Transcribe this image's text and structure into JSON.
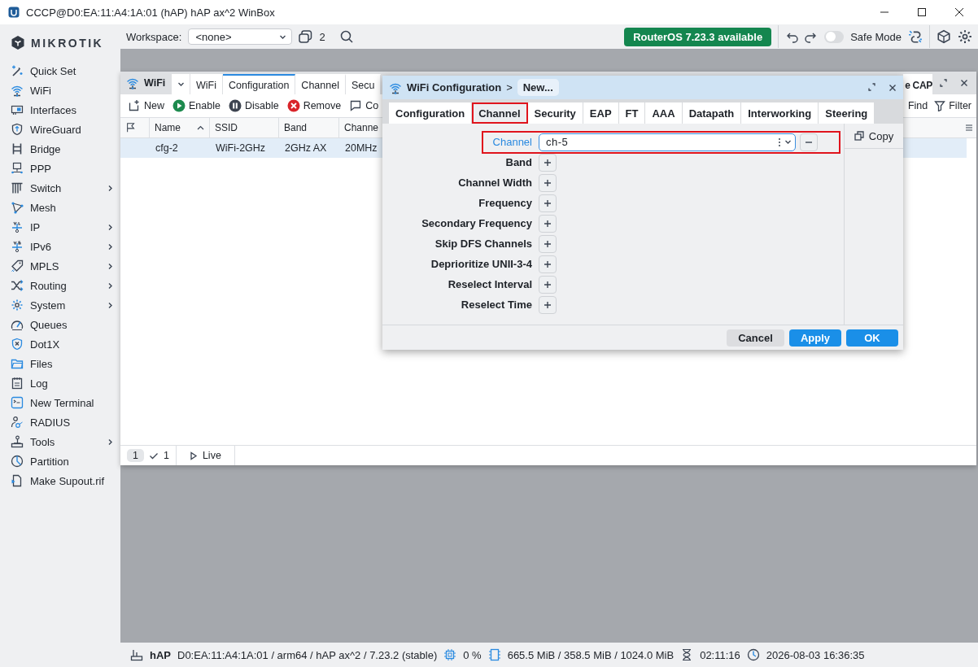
{
  "window": {
    "title": "CCCP@D0:EA:11:A4:1A:01 (hAP) hAP ax^2 WinBox"
  },
  "sidebar": {
    "brand": "MIKROTIK",
    "items": [
      {
        "label": "Quick Set",
        "submenu": false
      },
      {
        "label": "WiFi",
        "submenu": false
      },
      {
        "label": "Interfaces",
        "submenu": false
      },
      {
        "label": "WireGuard",
        "submenu": false
      },
      {
        "label": "Bridge",
        "submenu": false
      },
      {
        "label": "PPP",
        "submenu": false
      },
      {
        "label": "Switch",
        "submenu": true
      },
      {
        "label": "Mesh",
        "submenu": false
      },
      {
        "label": "IP",
        "submenu": true
      },
      {
        "label": "IPv6",
        "submenu": true
      },
      {
        "label": "MPLS",
        "submenu": true
      },
      {
        "label": "Routing",
        "submenu": true
      },
      {
        "label": "System",
        "submenu": true
      },
      {
        "label": "Queues",
        "submenu": false
      },
      {
        "label": "Dot1X",
        "submenu": false
      },
      {
        "label": "Files",
        "submenu": false
      },
      {
        "label": "Log",
        "submenu": false
      },
      {
        "label": "New Terminal",
        "submenu": false
      },
      {
        "label": "RADIUS",
        "submenu": false
      },
      {
        "label": "Tools",
        "submenu": true
      },
      {
        "label": "Partition",
        "submenu": false
      },
      {
        "label": "Make Supout.rif",
        "submenu": false
      }
    ]
  },
  "toolbar": {
    "workspace_label": "Workspace:",
    "workspace_value": "<none>",
    "windows_count": "2",
    "update_badge": "RouterOS 7.23.3 available",
    "safe_mode": {
      "label": "Safe Mode",
      "on": false
    }
  },
  "wifi_window": {
    "title": "WiFi",
    "tabs": [
      {
        "label": "WiFi",
        "selected": false
      },
      {
        "label": "Configuration",
        "selected": true
      },
      {
        "label": "Channel",
        "selected": false
      },
      {
        "label": "Secu",
        "selected": false
      }
    ],
    "right_tab": "e CAP",
    "actions": [
      "New",
      "Enable",
      "Disable",
      "Remove",
      "Co"
    ],
    "right_actions": [
      "Find",
      "Filter"
    ],
    "columns": [
      "Name",
      "SSID",
      "Band",
      "Channe"
    ],
    "rows": [
      {
        "cells": [
          "cfg-2",
          "WiFi-2GHz",
          "2GHz AX",
          "20MHz"
        ],
        "selected": true
      }
    ],
    "footer": {
      "total": "1",
      "selected_count": "1",
      "live": "Live"
    }
  },
  "dialog": {
    "title": "WiFi Configuration",
    "separator": ">",
    "crumb": "New...",
    "tabs": [
      {
        "label": "Configuration",
        "selected": false,
        "highlighted": false
      },
      {
        "label": "Channel",
        "selected": true,
        "highlighted": true
      },
      {
        "label": "Security",
        "selected": false,
        "highlighted": false
      },
      {
        "label": "EAP",
        "selected": false,
        "highlighted": false
      },
      {
        "label": "FT",
        "selected": false,
        "highlighted": false
      },
      {
        "label": "AAA",
        "selected": false,
        "highlighted": false
      },
      {
        "label": "Datapath",
        "selected": false,
        "highlighted": false
      },
      {
        "label": "Interworking",
        "selected": false,
        "highlighted": false
      },
      {
        "label": "Steering",
        "selected": false,
        "highlighted": false
      }
    ],
    "fields": [
      {
        "label": "Channel",
        "kind": "set",
        "value": "ch-5",
        "highlighted": true
      },
      {
        "label": "Band",
        "kind": "unset",
        "highlighted": false
      },
      {
        "label": "Channel Width",
        "kind": "unset",
        "highlighted": false
      },
      {
        "label": "Frequency",
        "kind": "unset",
        "highlighted": false
      },
      {
        "label": "Secondary Frequency",
        "kind": "unset",
        "highlighted": false
      },
      {
        "label": "Skip DFS Channels",
        "kind": "unset",
        "highlighted": false
      },
      {
        "label": "Deprioritize UNII-3-4",
        "kind": "unset",
        "highlighted": false
      },
      {
        "label": "Reselect Interval",
        "kind": "unset",
        "highlighted": false
      },
      {
        "label": "Reselect Time",
        "kind": "unset",
        "highlighted": false
      }
    ],
    "side_buttons": [
      "Copy"
    ],
    "buttons": [
      {
        "label": "Cancel",
        "kind": "secondary"
      },
      {
        "label": "Apply",
        "kind": "primary"
      },
      {
        "label": "OK",
        "kind": "primary"
      }
    ]
  },
  "status_bar": {
    "device": "hAP",
    "details": "D0:EA:11:A4:1A:01 / arm64 / hAP ax^2 / 7.23.2 (stable)",
    "cpu": "0 %",
    "memory": "665.5 MiB / 358.5 MiB / 1024.0 MiB",
    "uptime": "02:11:16",
    "clock": "2026-08-03 16:36:35"
  }
}
